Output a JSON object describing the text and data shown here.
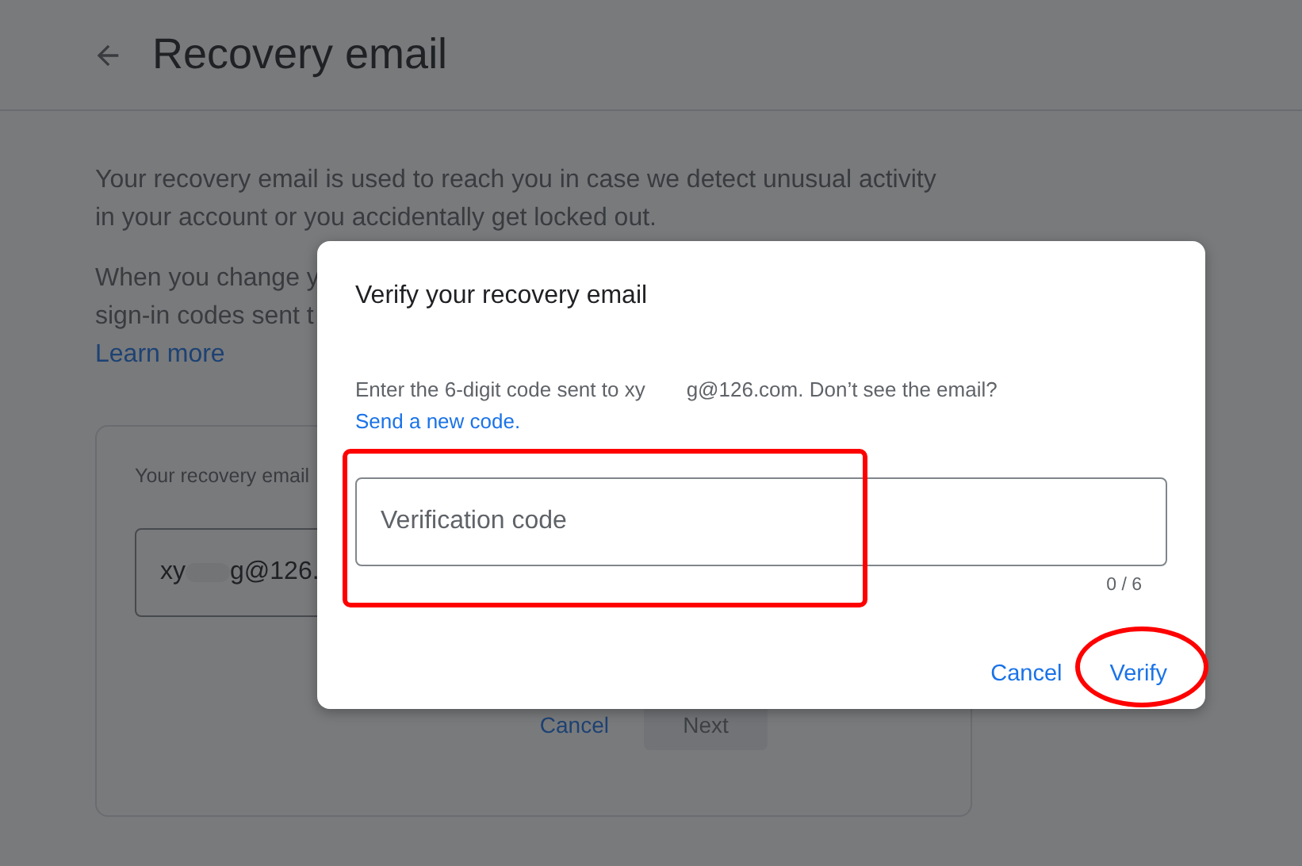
{
  "page": {
    "title": "Recovery email",
    "paragraphs": [
      {
        "text": "Your recovery email is used to reach you in case we detect unusual activity in your account or you accidentally get locked out."
      },
      {
        "lines": [
          "When you change y",
          "sign-in codes sent t"
        ]
      }
    ],
    "learn_more": "Learn more",
    "card": {
      "label": "Your recovery email",
      "email_start": "xy",
      "email_end": "g@126.",
      "buttons": [
        {
          "label": "Cancel",
          "kind": "text",
          "disabled": false
        },
        {
          "label": "Next",
          "kind": "filled",
          "disabled": true
        }
      ]
    }
  },
  "dialog": {
    "title": "Verify your recovery email",
    "message_start": "Enter the 6-digit code sent to xy",
    "message_end": "g@126.com. Don’t see the email?",
    "resend_link": "Send a new code.",
    "field": {
      "placeholder": "Verification code",
      "counter": "0 / 6"
    },
    "buttons": [
      {
        "label": "Cancel"
      },
      {
        "label": "Verify"
      }
    ]
  },
  "annotations": [
    {
      "kind": "rectangle"
    },
    {
      "kind": "ellipse"
    }
  ]
}
